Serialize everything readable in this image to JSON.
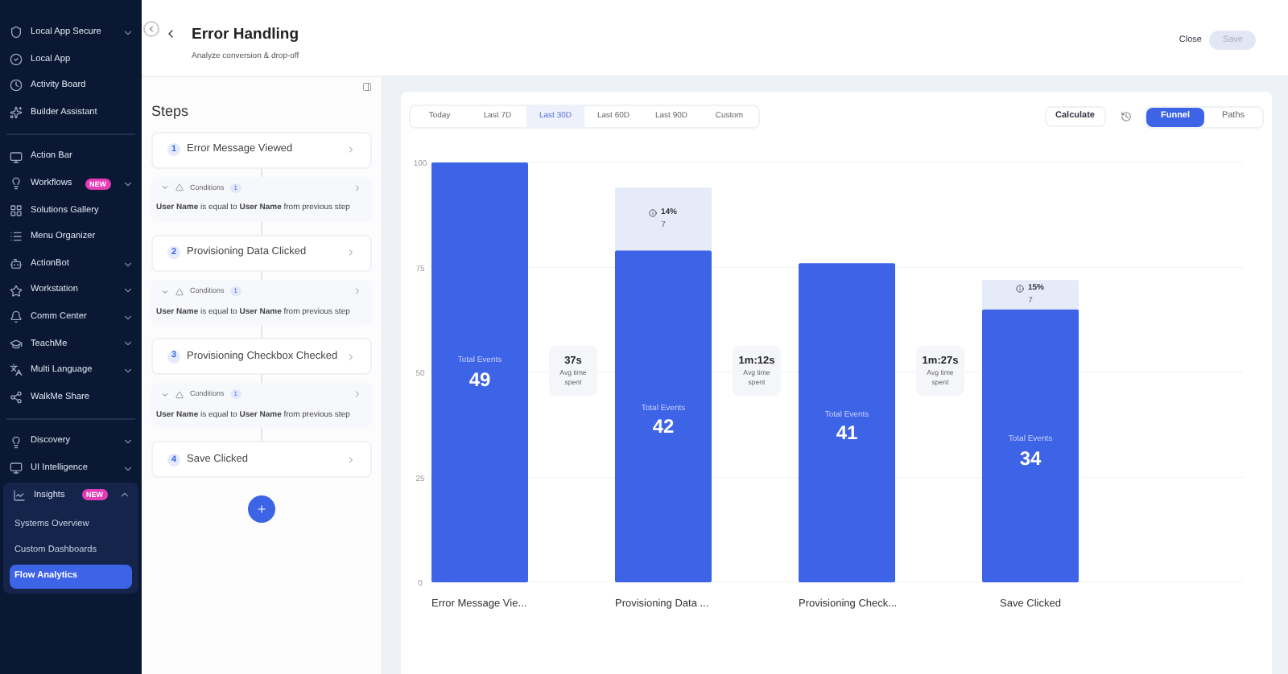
{
  "sidebar": {
    "items": [
      {
        "label": "Local App Secure",
        "expanded": false,
        "selected": false
      },
      {
        "label": "Local App",
        "selected": false
      },
      {
        "label": "Activity Board",
        "selected": false
      },
      {
        "label": "Builder Assistant",
        "selected": false
      },
      {
        "kind": "divider"
      },
      {
        "label": "Action Bar",
        "selected": false
      },
      {
        "label": "Workflows",
        "badge": "NEW",
        "expanded": false,
        "selected": false
      },
      {
        "label": "Solutions Gallery",
        "selected": false
      },
      {
        "label": "Menu Organizer",
        "selected": false
      },
      {
        "label": "ActionBot",
        "expanded": false,
        "selected": false
      },
      {
        "label": "Workstation",
        "expanded": false,
        "selected": false
      },
      {
        "label": "Comm Center",
        "expanded": false,
        "selected": false
      },
      {
        "label": "TeachMe",
        "expanded": false,
        "selected": false
      },
      {
        "label": "Multi Language",
        "expanded": false,
        "selected": false
      },
      {
        "label": "WalkMe Share",
        "selected": false
      },
      {
        "kind": "divider"
      },
      {
        "label": "Discovery",
        "expanded": false,
        "selected": false
      },
      {
        "label": "UI Intelligence",
        "expanded": false,
        "selected": false
      },
      {
        "label": "Insights",
        "badge": "NEW",
        "expanded": true,
        "selected": false,
        "children": [
          {
            "label": "Systems Overview",
            "selected": false
          },
          {
            "label": "Custom Dashboards",
            "selected": false
          },
          {
            "label": "Flow Analytics",
            "selected": true
          }
        ]
      }
    ]
  },
  "header": {
    "title": "Error Handling",
    "subtitle": "Analyze conversion & drop-off",
    "close": "Close",
    "save": "Save",
    "save_disabled": true
  },
  "steps_panel": {
    "title": "Steps",
    "steps": [
      {
        "number": "1",
        "label": "Error Message Viewed",
        "condition": {
          "label": "Conditions",
          "count": "1",
          "field": "User Name",
          "operator": "is equal to",
          "value": "User Name",
          "suffix": "from previous step"
        }
      },
      {
        "number": "2",
        "label": "Provisioning Data Clicked",
        "condition": {
          "label": "Conditions",
          "count": "1",
          "field": "User Name",
          "operator": "is equal to",
          "value": "User Name",
          "suffix": "from previous step"
        }
      },
      {
        "number": "3",
        "label": "Provisioning Checkbox Checked",
        "condition": {
          "label": "Conditions",
          "count": "1",
          "field": "User Name",
          "operator": "is equal to",
          "value": "User Name",
          "suffix": "from previous step"
        }
      },
      {
        "number": "4",
        "label": "Save Clicked"
      }
    ]
  },
  "toolbar": {
    "ranges": [
      {
        "label": "Today",
        "selected": false
      },
      {
        "label": "Last 7D",
        "selected": false
      },
      {
        "label": "Last 30D",
        "selected": true
      },
      {
        "label": "Last 60D",
        "selected": false
      },
      {
        "label": "Last 90D",
        "selected": false
      },
      {
        "label": "Custom",
        "selected": false
      }
    ],
    "calculate": "Calculate",
    "views": [
      {
        "label": "Funnel",
        "selected": true
      },
      {
        "label": "Paths",
        "selected": false
      }
    ]
  },
  "funnel": {
    "chart_data": {
      "type": "bar",
      "stacked": true,
      "categories": [
        "Error Message Vie...",
        "Provisioning Data ...",
        "Provisioning Check...",
        "Save Clicked"
      ],
      "series": [
        {
          "color": "#3d63e6",
          "values": [
            100,
            79,
            76,
            65
          ]
        },
        {
          "color": "#e6ebfa",
          "values": [
            null,
            15,
            null,
            7
          ]
        }
      ],
      "ylim": [
        0,
        100
      ],
      "yticks": [
        0,
        25,
        50,
        75,
        100
      ],
      "grid": true
    },
    "bars": [
      {
        "caption": "Total Events",
        "total": "49"
      },
      {
        "caption": "Total Events",
        "total": "42",
        "dropoff_pct": "14%",
        "dropoff_count": "7"
      },
      {
        "caption": "Total Events",
        "total": "41"
      },
      {
        "caption": "Total Events",
        "total": "34",
        "dropoff_pct": "15%",
        "dropoff_count": "7"
      }
    ],
    "gaps": [
      {
        "time": "37s",
        "caption": "Avg time spent"
      },
      {
        "time": "1m:12s",
        "caption": "Avg time spent"
      },
      {
        "time": "1m:27s",
        "caption": "Avg time spent"
      }
    ]
  }
}
